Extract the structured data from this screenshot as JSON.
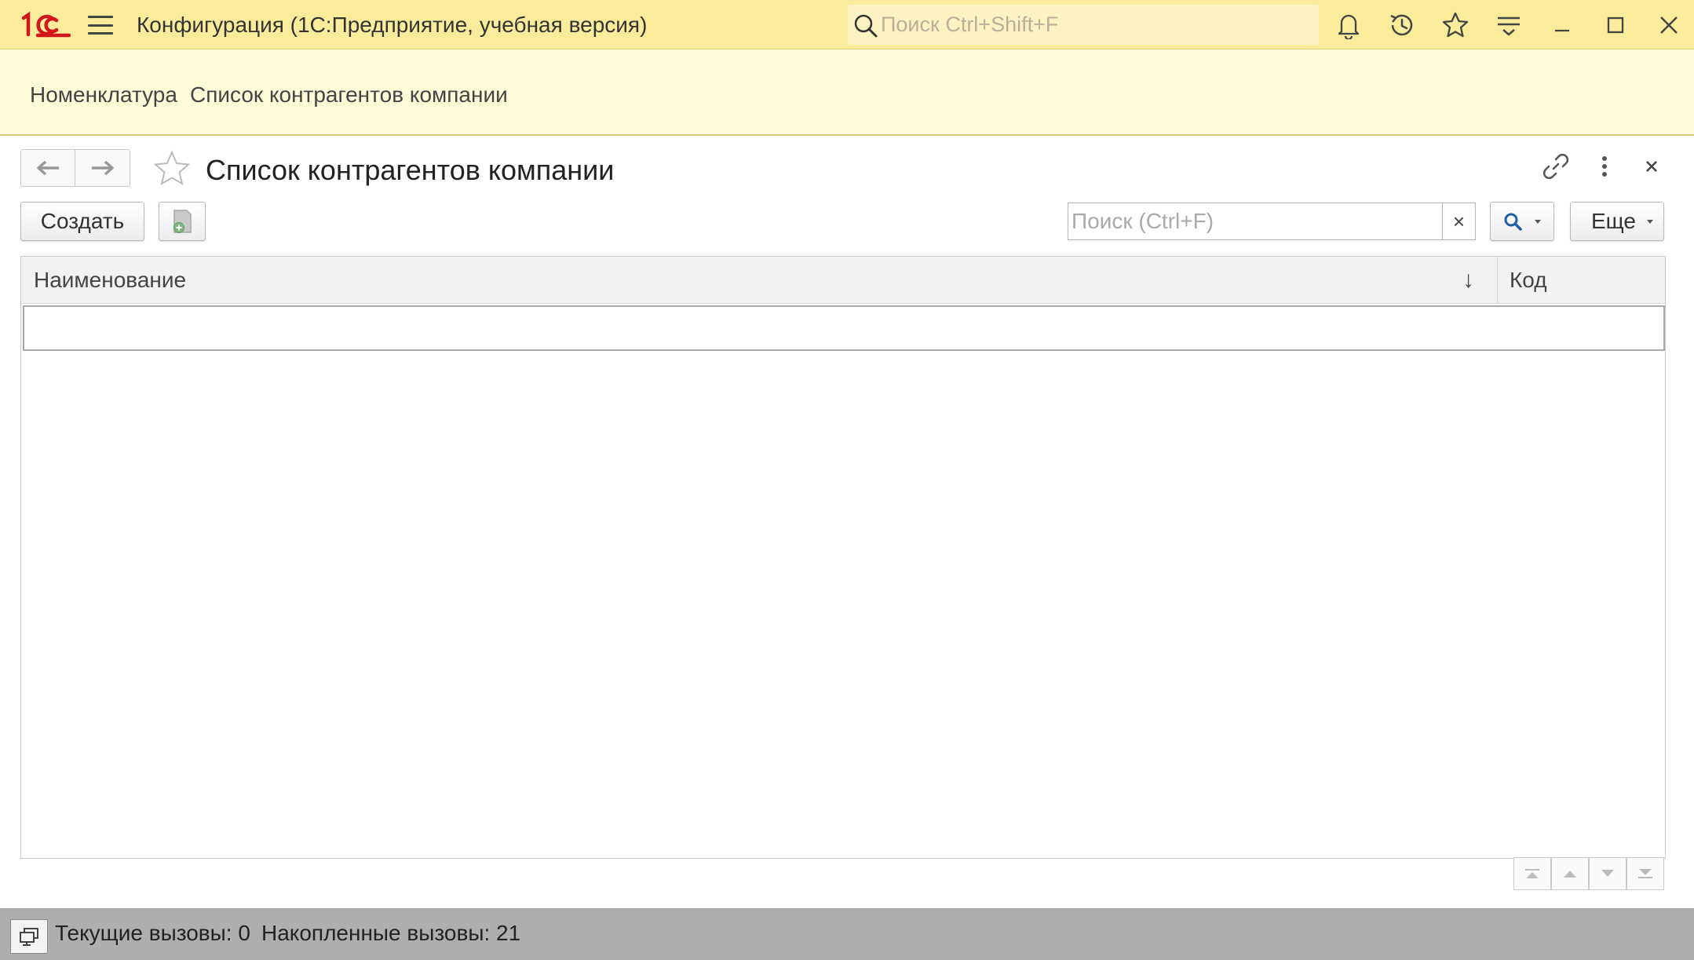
{
  "app": {
    "title": "Конфигурация  (1С:Предприятие, учебная версия)",
    "search_placeholder": "Поиск Ctrl+Shift+F",
    "accent_color": "#fbec9c",
    "logo_color": "#d2171c"
  },
  "sections": {
    "items": [
      {
        "label": "Номенклатура"
      },
      {
        "label": "Список контрагентов компании"
      }
    ]
  },
  "form": {
    "title": "Список контрагентов компании",
    "toolbar": {
      "create_label": "Создать",
      "search_placeholder": "Поиск (Ctrl+F)",
      "clear_label": "×",
      "more_label": "Еще"
    },
    "table": {
      "columns": [
        {
          "label": "Наименование",
          "sort": "↓"
        },
        {
          "label": "Код"
        }
      ],
      "rows": []
    }
  },
  "status": {
    "current_calls": "Текущие вызовы: 0",
    "accumulated_calls": "Накопленные вызовы: 21"
  }
}
